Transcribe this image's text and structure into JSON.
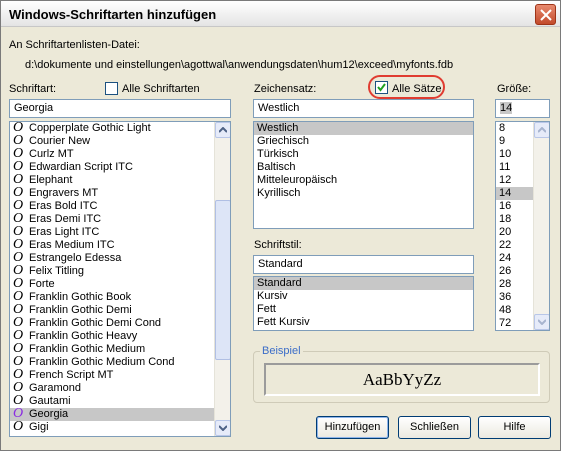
{
  "window": {
    "title": "Windows-Schriftarten hinzufügen",
    "source_label": "An Schriftartenlisten-Datei:",
    "source_path": "d:\\dokumente und einstellungen\\agottwal\\anwendungsdaten\\hum12\\exceed\\myfonts.fdb"
  },
  "font": {
    "label": "Schriftart:",
    "all_fonts_label": "Alle Schriftarten",
    "all_fonts_checked": false,
    "value": "Georgia",
    "items": [
      "Copperplate Gothic Light",
      "Courier New",
      "Curlz MT",
      "Edwardian Script ITC",
      "Elephant",
      "Engravers MT",
      "Eras Bold ITC",
      "Eras Demi ITC",
      "Eras Light ITC",
      "Eras Medium ITC",
      "Estrangelo Edessa",
      "Felix Titling",
      "Forte",
      "Franklin Gothic Book",
      "Franklin Gothic Demi",
      "Franklin Gothic Demi Cond",
      "Franklin Gothic Heavy",
      "Franklin Gothic Medium",
      "Franklin Gothic Medium Cond",
      "French Script MT",
      "Garamond",
      "Gautami",
      "Georgia",
      "Gigi"
    ],
    "selected": "Georgia",
    "glyph": "O",
    "glyph_icon": "opentype-font-icon"
  },
  "charset": {
    "label": "Zeichensatz:",
    "all_sets_label": "Alle Sätze",
    "all_sets_checked": true,
    "value": "Westlich",
    "items": [
      "Westlich",
      "Griechisch",
      "Türkisch",
      "Baltisch",
      "Mitteleuropäisch",
      "Kyrillisch"
    ],
    "selected": "Westlich"
  },
  "style": {
    "label": "Schriftstil:",
    "value": "Standard",
    "items": [
      "Standard",
      "Kursiv",
      "Fett",
      "Fett Kursiv"
    ],
    "selected": "Standard"
  },
  "size": {
    "label": "Größe:",
    "value": "14",
    "items": [
      "8",
      "9",
      "10",
      "11",
      "12",
      "14",
      "16",
      "18",
      "20",
      "22",
      "24",
      "26",
      "28",
      "36",
      "48",
      "72"
    ],
    "selected": "14"
  },
  "sample": {
    "label": "Beispiel",
    "text": "AaBbYyZz"
  },
  "buttons": {
    "add": "Hinzufügen",
    "close": "Schließen",
    "help": "Hilfe"
  },
  "colors": {
    "selection": "#c7c7c7",
    "highlight_oval": "#e03c31",
    "group_title": "#3b6dc8",
    "font_glyph_selected": "#8a2be2"
  }
}
